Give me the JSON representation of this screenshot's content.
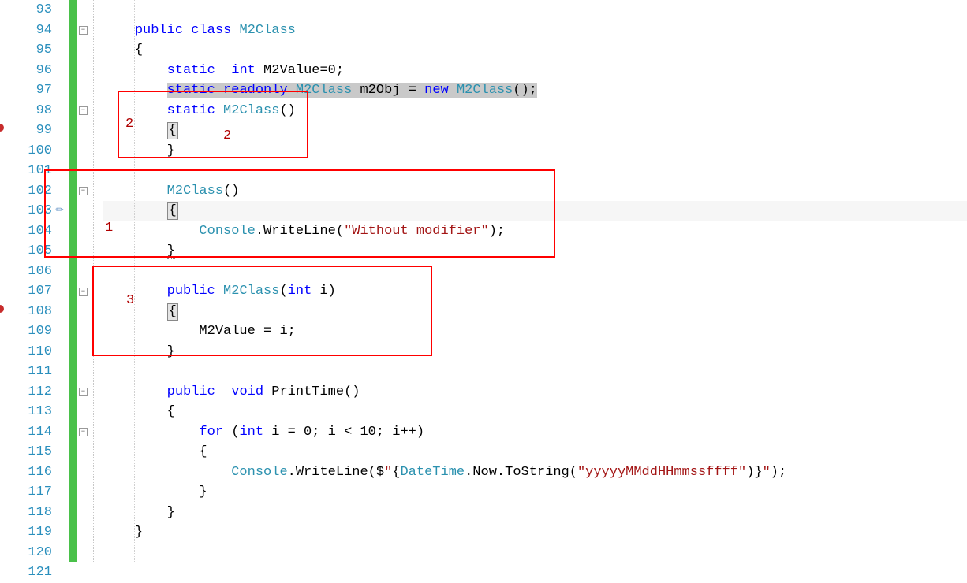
{
  "line_numbers": [
    "93",
    "94",
    "95",
    "96",
    "97",
    "98",
    "99",
    "100",
    "101",
    "102",
    "103",
    "104",
    "105",
    "106",
    "107",
    "108",
    "109",
    "110",
    "111",
    "112",
    "113",
    "114",
    "115",
    "116",
    "117",
    "118",
    "119",
    "120",
    "121"
  ],
  "code": {
    "l94_kw1": "public",
    "l94_kw2": "class",
    "l94_type": "M2Class",
    "l95_brace": "{",
    "l96_kw1": "static",
    "l96_kw2": "int",
    "l96_rest": " M2Value=0;",
    "l97_kw1": "static",
    "l97_kw2": "readonly",
    "l97_type1": "M2Class",
    "l97_var": " m2Obj = ",
    "l97_kw3": "new",
    "l97_type2": "M2Class",
    "l97_end": "();",
    "l98_kw": "static",
    "l98_type": "M2Class",
    "l98_end": "()",
    "l99_brace": "{",
    "l100_brace": "}",
    "l102_type": "M2Class",
    "l102_end": "()",
    "l103_brace": "{",
    "l104_type": "Console",
    "l104_call": ".WriteLine(",
    "l104_str": "\"Without modifier\"",
    "l104_end": ");",
    "l105_brace": "}",
    "l107_kw": "public",
    "l107_type": "M2Class",
    "l107_args_open": "(",
    "l107_args_kw": "int",
    "l107_args_rest": " i)",
    "l108_brace": "{",
    "l109_body": "M2Value = i;",
    "l110_brace": "}",
    "l112_kw1": "public",
    "l112_kw2": "void",
    "l112_name": " PrintTime()",
    "l113_brace": "{",
    "l114_kw1": "for",
    "l114_open": " (",
    "l114_kw2": "int",
    "l114_rest": " i = 0; i < 10; i++)",
    "l115_brace": "{",
    "l116_type": "Console",
    "l116_call1": ".WriteLine($",
    "l116_str1": "\"",
    "l116_interp_open": "{",
    "l116_type2": "DateTime",
    "l116_mid": ".Now.ToString(",
    "l116_str2": "\"yyyyyMMddHHmmssffff\"",
    "l116_close1": ")",
    "l116_interp_close": "}",
    "l116_str3": "\"",
    "l116_end": ");",
    "l117_brace": "}",
    "l118_brace": "}",
    "l119_brace": "}"
  },
  "annotations": {
    "label1": "1",
    "label2a": "2",
    "label2b": "2",
    "label3": "3"
  }
}
